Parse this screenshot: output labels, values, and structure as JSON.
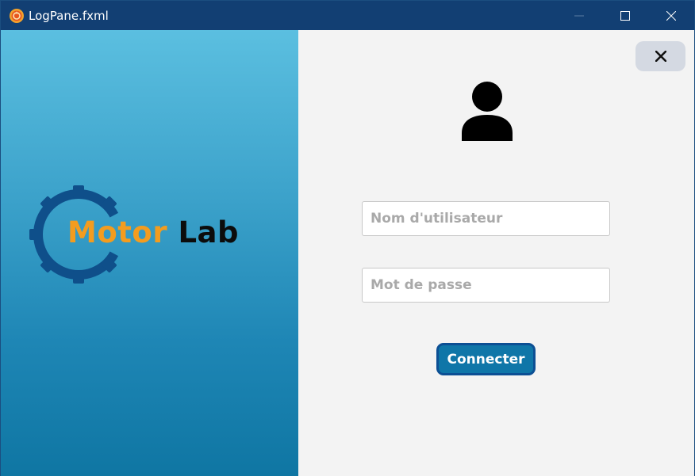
{
  "window": {
    "title": "LogPane.fxml",
    "app_icon": "app-logo-icon",
    "controls": {
      "minimize": "minimize-icon",
      "maximize": "maximize-icon",
      "close": "close-icon"
    }
  },
  "brand": {
    "word1": "Motor",
    "word2": "Lab",
    "icon": "gear-icon",
    "colors": {
      "accent": "#f39c1f",
      "gear": "#0f4f8a",
      "text": "#0c0c0c"
    }
  },
  "form": {
    "close_icon": "close-icon",
    "avatar_icon": "user-icon",
    "username": {
      "value": "",
      "placeholder": "Nom d'utilisateur"
    },
    "password": {
      "value": "",
      "placeholder": "Mot de passe"
    },
    "submit_label": "Connecter"
  },
  "colors": {
    "titlebar": "#123f73",
    "panel_gradient_top": "#5bbfe0",
    "panel_gradient_bottom": "#0f76a3",
    "button_bg": "#0f76a8",
    "button_border": "#0c4f94",
    "close_button_bg": "#d4d9e2"
  }
}
